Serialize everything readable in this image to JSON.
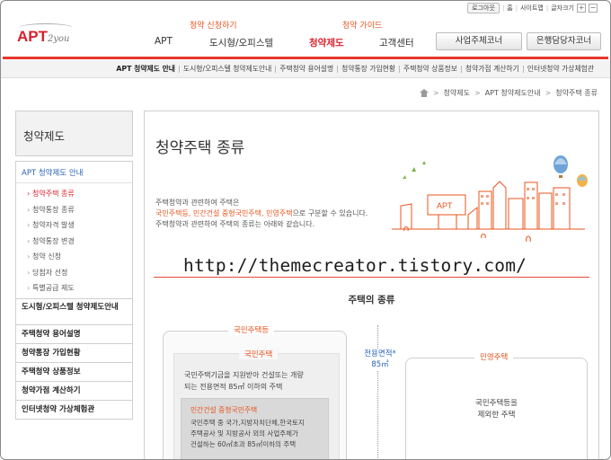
{
  "util": {
    "logout": "로그아웃",
    "home": "홈",
    "sitemap": "사이트맵",
    "fontsize": "글자크기",
    "plus": "+",
    "minus": "−"
  },
  "logo": {
    "main": "APT",
    "sub": "2you"
  },
  "gnb": {
    "caption_left": "청약 신청하기",
    "caption_right": "청약 가이드",
    "items": [
      "APT",
      "도시형/오피스텔",
      "청약제도",
      "고객센터"
    ],
    "buttons": [
      "사업주체코너",
      "은행담당자코너"
    ]
  },
  "lnb": {
    "items": [
      "APT 청약제도 안내",
      "도시형/오피스텔 청약제도안내",
      "주택청약 용어설명",
      "청약통장 가입현황",
      "주택청약 상품정보",
      "청약가점 계산하기",
      "인터넷청약 가상체험관"
    ]
  },
  "breadcrumb": [
    "청약제도",
    "APT 청약제도안내",
    "청약주택 종류"
  ],
  "side": {
    "title": "청약제도",
    "head": "APT 청약제도 안내",
    "sub": [
      "청약주택 종류",
      "청약통장 종류",
      "청약자격 발생",
      "청약통장 변경",
      "청약 신청",
      "당첨자 선정",
      "특별공급 제도"
    ],
    "items": [
      "도시형/오피스텔 청약제도안내",
      "주택청약 용어설명",
      "청약통장 가입현황",
      "주택청약 상품정보",
      "청약가점 계산하기",
      "인터넷청약 가상체험관"
    ]
  },
  "content": {
    "title": "청약주택 종류",
    "intro1": "주택청약과 관련하여 주택은",
    "intro2_hl": "국민주택등, 민간건설 중형국민주택, 민영주택",
    "intro2_rest": "으로 구분할 수 있습니다.",
    "intro3": "주택청약과 관련하여 주택의 종류는 아래와 같습니다.",
    "watermark": "http://themecreator.tistory.com/",
    "section": "주택의 종류",
    "outer_tag": "국민주택등",
    "mid_tag": "국민주택",
    "mid_text1": "국민주택기금을 지원받아 건설또는 개량",
    "mid_text2": "되는 전용면적 85㎡ 이하의 주택",
    "inner_tag": "민간건설 중형국민주택",
    "inner_text1": "국민주택 중 국가,지방자치단체,한국토지",
    "inner_text2": "주택공사 및 지방공사 외의 사업주체가",
    "inner_text3": "건설하는 60㎡초과 85㎡이하의 주택",
    "area_label1": "전용면적*",
    "area_label2": "85㎡",
    "right_tag": "민영주택",
    "right_text1": "국민주택등을",
    "right_text2": "제외한 주택",
    "illus_sign": "APT"
  },
  "colors": {
    "accent": "#d8212c",
    "orange": "#e8541e",
    "link_blue": "#2b63b8"
  }
}
